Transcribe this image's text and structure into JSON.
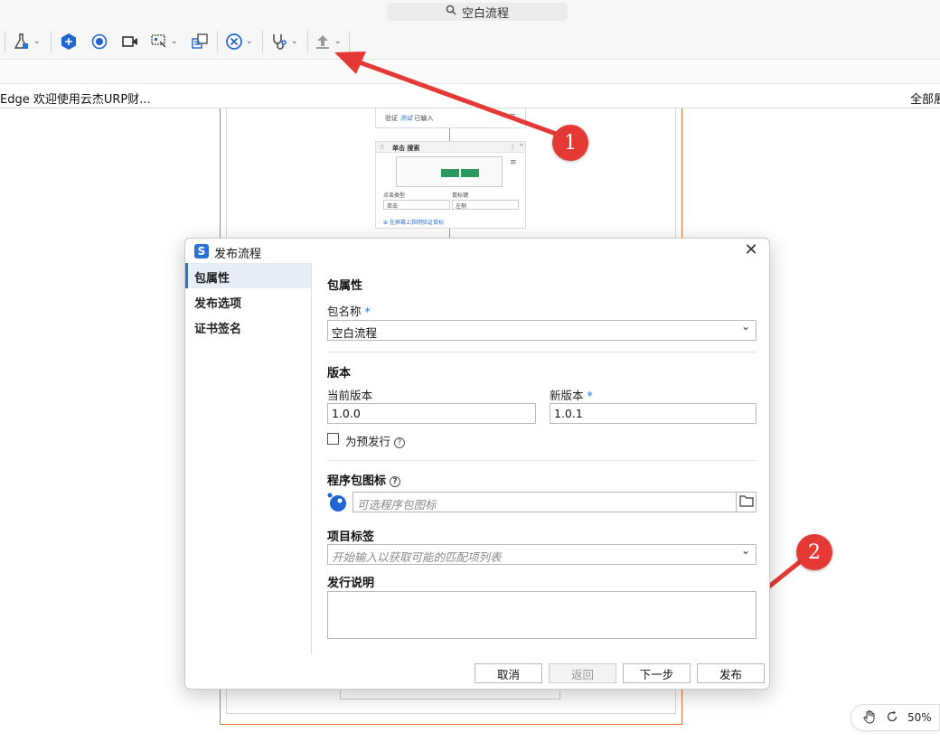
{
  "window": {
    "title": "空白流程"
  },
  "tab_bar": {
    "left_text": "Edge 欢迎使用云杰URP财...",
    "right_text": "全部展"
  },
  "canvas": {
    "card1_prefix": "验证",
    "card1_link": "测试",
    "card1_suffix": "已输入",
    "card2_title": "单击 搜索",
    "card2_click_type_label": "点击类型",
    "card2_click_type_value": "单击",
    "card2_mouse_key_label": "鼠标键",
    "card2_mouse_key_value": "左侧",
    "card2_link": "在屏幕上指明验证目标"
  },
  "zoom": {
    "level": "50%"
  },
  "dialog": {
    "title": "发布流程",
    "nav": [
      "包属性",
      "发布选项",
      "证书签名"
    ],
    "section_title": "包属性",
    "package_name_label": "包名称",
    "required_mark": "*",
    "package_name_value": "空白流程",
    "version_section": "版本",
    "current_version_label": "当前版本",
    "current_version_value": "1.0.0",
    "new_version_label": "新版本",
    "new_version_value": "1.0.1",
    "prerelease_label": "为预发行",
    "icon_label": "程序包图标",
    "icon_placeholder": "可选程序包图标",
    "tags_label": "项目标签",
    "tags_placeholder": "开始输入以获取可能的匹配项列表",
    "release_notes_label": "发行说明",
    "buttons": {
      "cancel": "取消",
      "back": "返回",
      "next": "下一步",
      "publish": "发布"
    }
  },
  "annotations": {
    "badge1": "1",
    "badge2": "2",
    "color": "#e53935"
  }
}
